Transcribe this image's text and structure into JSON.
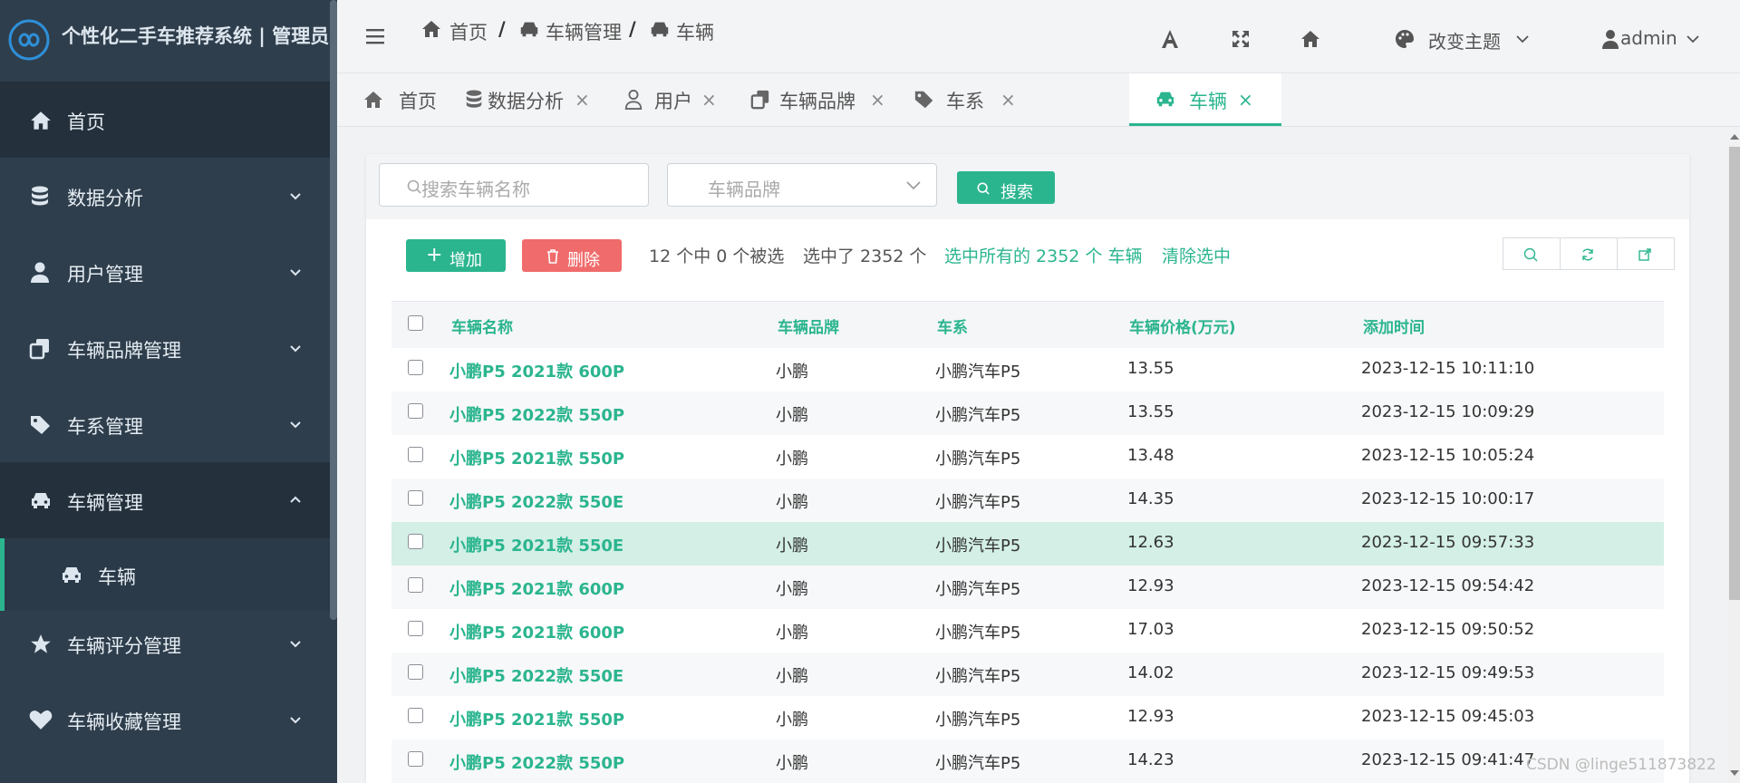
{
  "app": {
    "brand": "个性化二手车推荐系统 | 管理员"
  },
  "sidebar": {
    "items": [
      {
        "label": "首页",
        "icon": "home-icon"
      },
      {
        "label": "数据分析",
        "icon": "database-icon"
      },
      {
        "label": "用户管理",
        "icon": "user-icon"
      },
      {
        "label": "车辆品牌管理",
        "icon": "copy-icon"
      },
      {
        "label": "车系管理",
        "icon": "tags-icon"
      },
      {
        "label": "车辆管理",
        "icon": "car-icon"
      },
      {
        "label": "车辆",
        "icon": "car-icon"
      },
      {
        "label": "车辆评分管理",
        "icon": "star-icon"
      },
      {
        "label": "车辆收藏管理",
        "icon": "heart-icon"
      }
    ]
  },
  "header": {
    "breadcrumb": [
      "首页",
      "/",
      "车辆管理",
      "/",
      "车辆"
    ],
    "theme_label": "改变主题",
    "user_label": "admin"
  },
  "tabs": [
    {
      "label": "首页",
      "closable": false
    },
    {
      "label": "数据分析",
      "closable": true
    },
    {
      "label": "用户",
      "closable": true
    },
    {
      "label": "车辆品牌",
      "closable": true
    },
    {
      "label": "车系",
      "closable": true
    },
    {
      "label": "车辆",
      "closable": true,
      "active": true
    }
  ],
  "close_glyph": "×",
  "search": {
    "name_placeholder": "搜索车辆名称",
    "brand_placeholder": "车辆品牌",
    "search_button": "搜索"
  },
  "actions": {
    "add_button": "增加",
    "delete_button": "删除",
    "selected_count": "12 个中 0 个被选",
    "selected_total": "选中了 2352 个",
    "select_all": "选中所有的 2352 个 车辆",
    "clear_selection": "清除选中"
  },
  "table": {
    "columns": [
      "车辆名称",
      "车辆品牌",
      "车系",
      "车辆价格(万元)",
      "添加时间"
    ],
    "rows": [
      {
        "name": "小鹏P5 2021款 600P",
        "brand": "小鹏",
        "series": "小鹏汽车P5",
        "price": "13.55",
        "time": "2023-12-15 10:11:10"
      },
      {
        "name": "小鹏P5 2022款 550P",
        "brand": "小鹏",
        "series": "小鹏汽车P5",
        "price": "13.55",
        "time": "2023-12-15 10:09:29"
      },
      {
        "name": "小鹏P5 2021款 550P",
        "brand": "小鹏",
        "series": "小鹏汽车P5",
        "price": "13.48",
        "time": "2023-12-15 10:05:24"
      },
      {
        "name": "小鹏P5 2022款 550E",
        "brand": "小鹏",
        "series": "小鹏汽车P5",
        "price": "14.35",
        "time": "2023-12-15 10:00:17"
      },
      {
        "name": "小鹏P5 2021款 550E",
        "brand": "小鹏",
        "series": "小鹏汽车P5",
        "price": "12.63",
        "time": "2023-12-15 09:57:33"
      },
      {
        "name": "小鹏P5 2021款 600P",
        "brand": "小鹏",
        "series": "小鹏汽车P5",
        "price": "12.93",
        "time": "2023-12-15 09:54:42"
      },
      {
        "name": "小鹏P5 2021款 600P",
        "brand": "小鹏",
        "series": "小鹏汽车P5",
        "price": "17.03",
        "time": "2023-12-15 09:50:52"
      },
      {
        "name": "小鹏P5 2022款 550E",
        "brand": "小鹏",
        "series": "小鹏汽车P5",
        "price": "14.02",
        "time": "2023-12-15 09:49:53"
      },
      {
        "name": "小鹏P5 2021款 550P",
        "brand": "小鹏",
        "series": "小鹏汽车P5",
        "price": "12.93",
        "time": "2023-12-15 09:45:03"
      },
      {
        "name": "小鹏P5 2022款 550P",
        "brand": "小鹏",
        "series": "小鹏汽车P5",
        "price": "14.23",
        "time": "2023-12-15 09:41:47"
      }
    ],
    "highlighted_row": 4
  },
  "colors": {
    "accent": "#2bb58f",
    "danger": "#f06b6b",
    "sidebar": "#2f3e4c",
    "row_highlight": "#d3efe6"
  },
  "watermark": "CSDN @linge511873822"
}
